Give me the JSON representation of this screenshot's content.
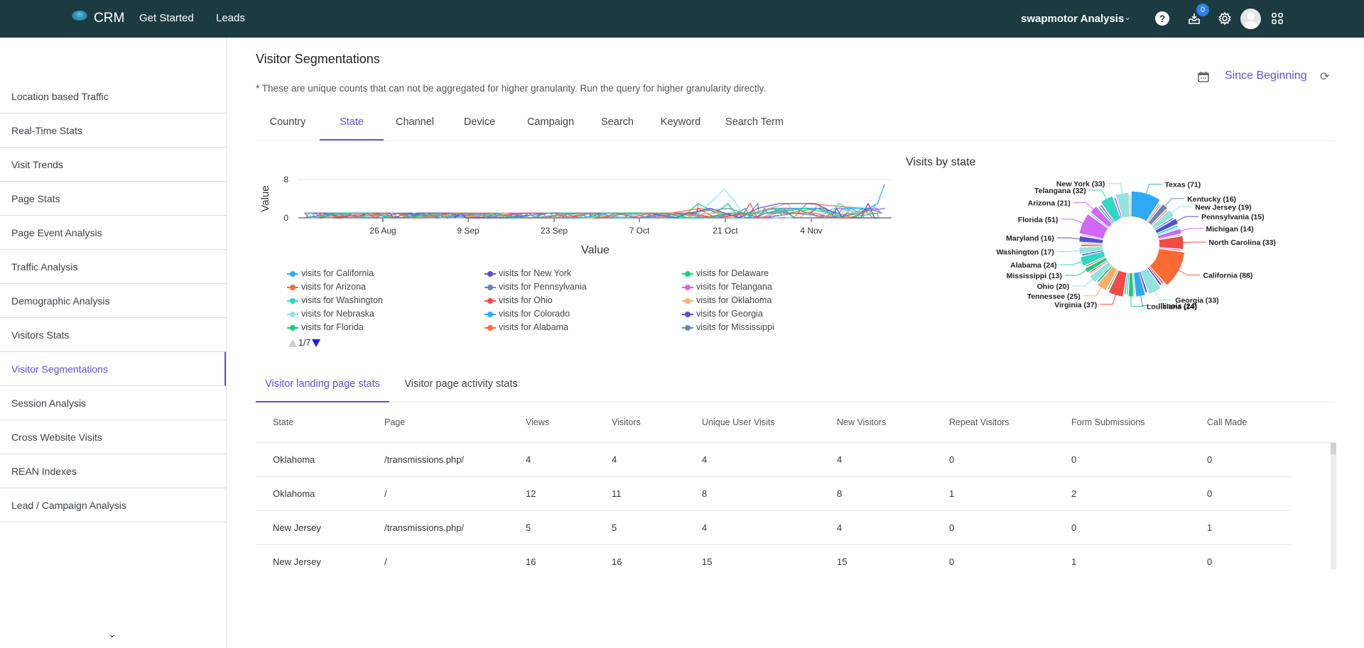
{
  "topbar": {
    "brand": "CRM",
    "nav": [
      "Get Started",
      "Leads"
    ],
    "org_name": "swapmotor Analysis",
    "notification_count": "0",
    "icons": [
      "help-icon",
      "inbox-download-icon",
      "gear-icon",
      "avatar",
      "apps-grid-icon"
    ]
  },
  "sidebar": {
    "items": [
      {
        "label": "Location based Traffic",
        "active": false
      },
      {
        "label": "Real-Time Stats",
        "active": false
      },
      {
        "label": "Visit Trends",
        "active": false
      },
      {
        "label": "Page Stats",
        "active": false
      },
      {
        "label": "Page Event Analysis",
        "active": false
      },
      {
        "label": "Traffic Analysis",
        "active": false
      },
      {
        "label": "Demographic Analysis",
        "active": false
      },
      {
        "label": "Visitors Stats",
        "active": false
      },
      {
        "label": "Visitor Segmentations",
        "active": true
      },
      {
        "label": "Session Analysis",
        "active": false
      },
      {
        "label": "Cross Website Visits",
        "active": false
      },
      {
        "label": "REAN Indexes",
        "active": false
      },
      {
        "label": "Lead / Campaign Analysis",
        "active": false
      }
    ],
    "collapse_icon": "chevron-down-icon"
  },
  "main": {
    "title": "Visitor Segmentations",
    "note": "* These are unique counts that can not be aggregated for higher granularity. Run the query for higher granularity directly.",
    "date_range": "Since Beginning",
    "tabs": [
      {
        "label": "Country",
        "active": false
      },
      {
        "label": "State",
        "active": true
      },
      {
        "label": "Channel",
        "active": false
      },
      {
        "label": "Device",
        "active": false
      },
      {
        "label": "Campaign",
        "active": false
      },
      {
        "label": "Search",
        "active": false
      },
      {
        "label": "Keyword",
        "active": false
      },
      {
        "label": "Search Term",
        "active": false
      }
    ],
    "legend_pager": "1/7",
    "subtabs": [
      {
        "label": "Visitor landing page stats",
        "active": true
      },
      {
        "label": "Visitor page activity stats",
        "active": false
      }
    ],
    "table": {
      "columns": [
        "State",
        "Page",
        "Views",
        "Visitors",
        "Unique User Visits",
        "New Visitors",
        "Repeat Visitors",
        "Form Submissions",
        "Call Made"
      ],
      "rows": [
        [
          "Oklahoma",
          "/transmissions.php/",
          "4",
          "4",
          "4",
          "4",
          "0",
          "0",
          "0"
        ],
        [
          "Oklahoma",
          "/",
          "12",
          "11",
          "8",
          "8",
          "1",
          "2",
          "0"
        ],
        [
          "New Jersey",
          "/transmissions.php/",
          "5",
          "5",
          "4",
          "4",
          "0",
          "0",
          "1"
        ],
        [
          "New Jersey",
          "/",
          "16",
          "16",
          "15",
          "15",
          "0",
          "1",
          "0"
        ]
      ]
    }
  },
  "chart_data": [
    {
      "type": "line",
      "title": "",
      "xlabel": "Value",
      "ylabel": "Value",
      "ylim": [
        0,
        8
      ],
      "y_ticks": [
        "0",
        "8"
      ],
      "x_ticks": [
        "26 Aug",
        "9 Sep",
        "23 Sep",
        "7 Oct",
        "21 Oct",
        "4 Nov"
      ],
      "x_range": [
        "16 Aug",
        "22 Nov"
      ],
      "grid": true,
      "legend_placement": "bottom",
      "series": [
        {
          "name": "visits for California",
          "color": "#2eaaf5"
        },
        {
          "name": "visits for New York",
          "color": "#5a4fcf"
        },
        {
          "name": "visits for Delaware",
          "color": "#14d07a"
        },
        {
          "name": "visits for Arizona",
          "color": "#ff6a33"
        },
        {
          "name": "visits for Pennsylvania",
          "color": "#6b86b6"
        },
        {
          "name": "visits for Telangana",
          "color": "#d266f5"
        },
        {
          "name": "visits for Washington",
          "color": "#2ed8c3"
        },
        {
          "name": "visits for Ohio",
          "color": "#f44a44"
        },
        {
          "name": "visits for Oklahoma",
          "color": "#ffab66"
        },
        {
          "name": "visits for Nebraska",
          "color": "#92e5df"
        },
        {
          "name": "visits for Colorado",
          "color": "#2eaaf5"
        },
        {
          "name": "visits for Georgia",
          "color": "#5a4fcf"
        },
        {
          "name": "visits for Florida",
          "color": "#14d07a"
        },
        {
          "name": "visits for Alabama",
          "color": "#ff6a33"
        },
        {
          "name": "visits for Mississippi",
          "color": "#6b86b6"
        }
      ],
      "peak_values_note": "most daily values 0–2; peaks ~6 near 19 Oct and ~7 near 20 Nov"
    },
    {
      "type": "pie",
      "title": "Visits by state",
      "donut": true,
      "labeled_slices": [
        {
          "label": "Texas",
          "value": 71,
          "color": "#2eaaf5"
        },
        {
          "label": "Kentucky",
          "value": 16,
          "color": "#6b86b6"
        },
        {
          "label": "New Jersey",
          "value": 19,
          "color": "#92e5df"
        },
        {
          "label": "Pennsylvania",
          "value": 15,
          "color": "#5a4fcf"
        },
        {
          "label": "Michigan",
          "value": 14,
          "color": "#d266f5"
        },
        {
          "label": "North Carolina",
          "value": 33,
          "color": "#f44a44"
        },
        {
          "label": "California",
          "value": 88,
          "color": "#ff6a33"
        },
        {
          "label": "Georgia",
          "value": 33,
          "color": "#92e5df"
        },
        {
          "label": "Illinois",
          "value": 24,
          "color": "#2eaaf5"
        },
        {
          "label": "Louisiana",
          "value": 14,
          "color": "#14d07a"
        },
        {
          "label": "Virginia",
          "value": 37,
          "color": "#f44a44"
        },
        {
          "label": "Tennessee",
          "value": 25,
          "color": "#ffab66"
        },
        {
          "label": "Ohio",
          "value": 20,
          "color": "#92e5df"
        },
        {
          "label": "Mississippi",
          "value": 13,
          "color": "#14d07a"
        },
        {
          "label": "Alabama",
          "value": 24,
          "color": "#2ed8c3"
        },
        {
          "label": "Washington",
          "value": 17,
          "color": "#92e5df"
        },
        {
          "label": "Maryland",
          "value": 16,
          "color": "#5a4fcf"
        },
        {
          "label": "Florida",
          "value": 51,
          "color": "#d266f5"
        },
        {
          "label": "Arizona",
          "value": 21,
          "color": "#d266f5"
        },
        {
          "label": "Telangana",
          "value": 32,
          "color": "#2ed8c3"
        },
        {
          "label": "New York",
          "value": 33,
          "color": "#92e5df"
        }
      ]
    }
  ]
}
